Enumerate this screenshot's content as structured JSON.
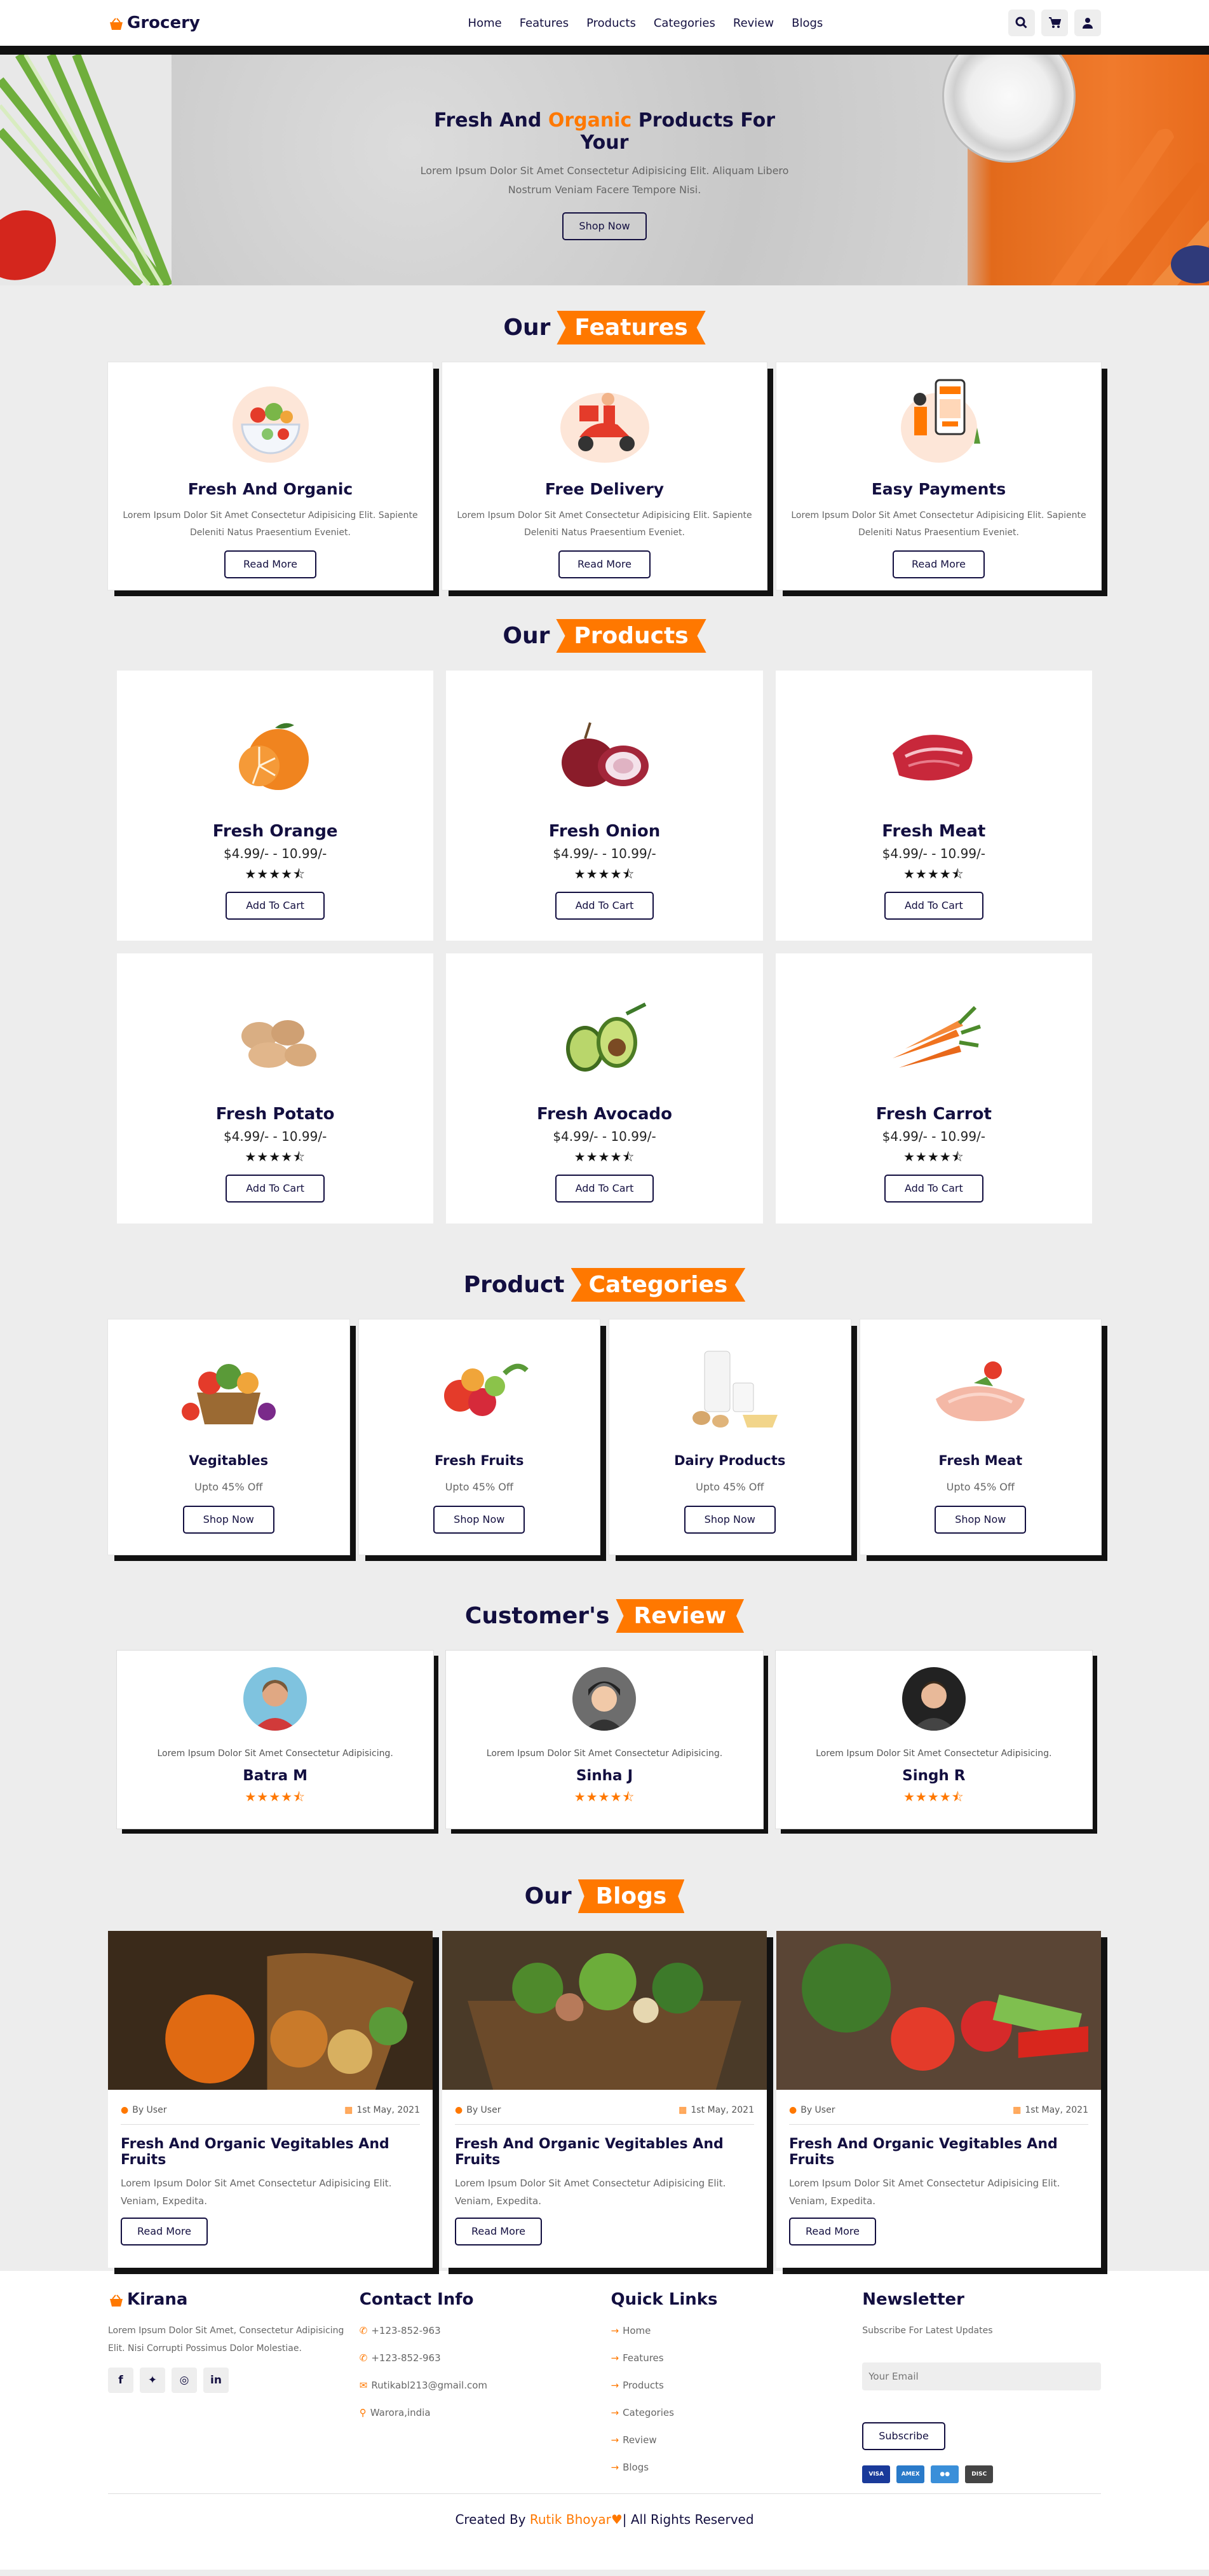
{
  "header": {
    "logo": "Grocery",
    "nav": [
      "Home",
      "Features",
      "Products",
      "Categories",
      "Review",
      "Blogs"
    ]
  },
  "hero": {
    "title_pre": "Fresh And ",
    "title_accent": "Organic",
    "title_post": " Products For Your",
    "text": "Lorem Ipsum Dolor Sit Amet Consectetur Adipisicing Elit. Aliquam Libero Nostrum Veniam Facere Tempore Nisi.",
    "button": "Shop Now"
  },
  "features": {
    "heading_pre": "Our",
    "heading_accent": "Features",
    "items": [
      {
        "title": "Fresh And Organic",
        "text": "Lorem Ipsum Dolor Sit Amet Consectetur Adipisicing Elit. Sapiente Deleniti Natus Praesentium Eveniet.",
        "button": "Read More"
      },
      {
        "title": "Free Delivery",
        "text": "Lorem Ipsum Dolor Sit Amet Consectetur Adipisicing Elit. Sapiente Deleniti Natus Praesentium Eveniet.",
        "button": "Read More"
      },
      {
        "title": "Easy Payments",
        "text": "Lorem Ipsum Dolor Sit Amet Consectetur Adipisicing Elit. Sapiente Deleniti Natus Praesentium Eveniet.",
        "button": "Read More"
      }
    ]
  },
  "products": {
    "heading_pre": "Our",
    "heading_accent": "Products",
    "items": [
      {
        "name": "Fresh Orange",
        "price": "$4.99/- - 10.99/-",
        "stars": "★★★★⯪",
        "button": "Add To Cart"
      },
      {
        "name": "Fresh Onion",
        "price": "$4.99/- - 10.99/-",
        "stars": "★★★★⯪",
        "button": "Add To Cart"
      },
      {
        "name": "Fresh Meat",
        "price": "$4.99/- - 10.99/-",
        "stars": "★★★★⯪",
        "button": "Add To Cart"
      },
      {
        "name": "Fresh Potato",
        "price": "$4.99/- - 10.99/-",
        "stars": "★★★★⯪",
        "button": "Add To Cart"
      },
      {
        "name": "Fresh Avocado",
        "price": "$4.99/- - 10.99/-",
        "stars": "★★★★⯪",
        "button": "Add To Cart"
      },
      {
        "name": "Fresh Carrot",
        "price": "$4.99/- - 10.99/-",
        "stars": "★★★★⯪",
        "button": "Add To Cart"
      }
    ]
  },
  "categories": {
    "heading_pre": "Product",
    "heading_accent": "Categories",
    "items": [
      {
        "name": "Vegitables",
        "offer": "Upto 45% Off",
        "button": "Shop Now"
      },
      {
        "name": "Fresh Fruits",
        "offer": "Upto 45% Off",
        "button": "Shop Now"
      },
      {
        "name": "Dairy Products",
        "offer": "Upto 45% Off",
        "button": "Shop Now"
      },
      {
        "name": "Fresh Meat",
        "offer": "Upto 45% Off",
        "button": "Shop Now"
      }
    ]
  },
  "reviews": {
    "heading_pre": "Customer's",
    "heading_accent": "Review",
    "items": [
      {
        "text": "Lorem Ipsum Dolor Sit Amet Consectetur Adipisicing.",
        "name": "Batra M",
        "stars": "★★★★⯪"
      },
      {
        "text": "Lorem Ipsum Dolor Sit Amet Consectetur Adipisicing.",
        "name": "Sinha J",
        "stars": "★★★★⯪"
      },
      {
        "text": "Lorem Ipsum Dolor Sit Amet Consectetur Adipisicing.",
        "name": "Singh R",
        "stars": "★★★★⯪"
      }
    ]
  },
  "blogs": {
    "heading_pre": "Our",
    "heading_accent": "Blogs",
    "items": [
      {
        "author": "By User",
        "date": "1st May, 2021",
        "title": "Fresh And Organic Vegitables And Fruits",
        "text": "Lorem Ipsum Dolor Sit Amet Consectetur Adipisicing Elit. Veniam, Expedita.",
        "button": "Read More"
      },
      {
        "author": "By User",
        "date": "1st May, 2021",
        "title": "Fresh And Organic Vegitables And Fruits",
        "text": "Lorem Ipsum Dolor Sit Amet Consectetur Adipisicing Elit. Veniam, Expedita.",
        "button": "Read More"
      },
      {
        "author": "By User",
        "date": "1st May, 2021",
        "title": "Fresh And Organic Vegitables And Fruits",
        "text": "Lorem Ipsum Dolor Sit Amet Consectetur Adipisicing Elit. Veniam, Expedita.",
        "button": "Read More"
      }
    ]
  },
  "footer": {
    "brand": "Kirana",
    "brand_text": "Lorem Ipsum Dolor Sit Amet, Consectetur Adipisicing Elit. Nisi Corrupti Possimus Dolor Molestiae.",
    "contact_title": "Contact Info",
    "contacts": [
      "+123-852-963",
      "+123-852-963",
      "Rutikabl213@gmail.com",
      "Warora,india"
    ],
    "links_title": "Quick Links",
    "links": [
      "Home",
      "Features",
      "Products",
      "Categories",
      "Review",
      "Blogs"
    ],
    "news_title": "Newsletter",
    "news_text": "Subscribe For Latest Updates",
    "email_placeholder": "Your Email",
    "subscribe": "Subscribe",
    "credit_pre": "Created By ",
    "credit_name": "Rutik Bhoyar",
    "credit_post": "| All Rights Reserved"
  },
  "colors": {
    "accent": "#ff7800",
    "dark": "#130f40"
  }
}
